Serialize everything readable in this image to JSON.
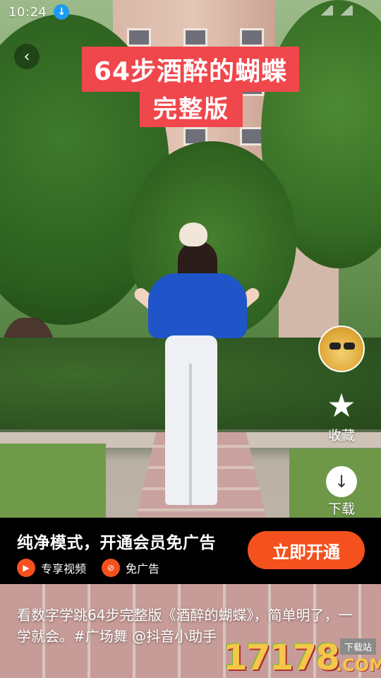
{
  "status_bar": {
    "time": "10:24"
  },
  "video": {
    "title_line1": "64步酒醉的蝴蝶",
    "title_line2": "完整版"
  },
  "actions": {
    "favorite_label": "收藏",
    "download_label": "下载"
  },
  "vip_banner": {
    "title": "纯净模式，开通会员免广告",
    "perk1": "专享视频",
    "perk2": "免广告",
    "button": "立即开通"
  },
  "caption": "看数字学跳64步完整版《酒醉的蝴蝶》，简单明了，一学就会。#广场舞 @抖音小助手",
  "watermark": {
    "number": "17178",
    "domain": ".COM",
    "tag": "下载站"
  },
  "colors": {
    "accent": "#f4511e",
    "title_bg": "#f0474c",
    "download_badge": "#1e9bf0"
  }
}
